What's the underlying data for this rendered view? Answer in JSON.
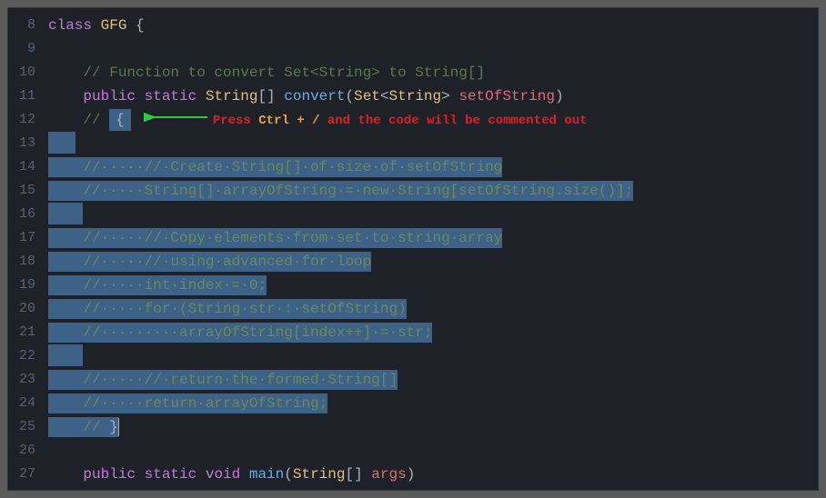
{
  "gutter": {
    "start": 8,
    "end": 27
  },
  "annotation": {
    "press": "Press",
    "key": "Ctrl + /",
    "rest": "and the code will be commented out"
  },
  "lines": {
    "l8_class": "class",
    "l8_gfg": " GFG ",
    "l8_brace": "{",
    "l10_c": "    // Function to convert Set<String> to String[]",
    "l11_pub": "    public",
    "l11_static": " static",
    "l11_string": " String",
    "l11_arr": "[] ",
    "l11_convert": "convert",
    "l11_open": "(",
    "l11_set": "Set",
    "l11_lt": "<",
    "l11_str2": "String",
    "l11_gt": "> ",
    "l11_param": "setOfString",
    "l11_close": ")",
    "l12_c": "    // ",
    "l12_brace": "{",
    "l13_sel": "",
    "l14_c": "    //·····//·Create·String[]·of·size·of·setOfString",
    "l15_c": "    //·····String[]·arrayOfString·=·new·String[setOfString.size()];",
    "l17_c": "    //·····//·Copy·elements·from·set·to·string·array",
    "l18_c": "    //·····//·using·advanced·for·loop",
    "l19_c": "    //·····int·index·=·0;",
    "l20_c": "    //·····for·(String·str·:·setOfString)",
    "l21_c": "    //·········arrayOfString[index++]·=·str;",
    "l23_c": "    //·····//·return·the·formed·String[]",
    "l24_c": "    //·····return·arrayOfString;",
    "l25_c": "    // ",
    "l25_brace": "}",
    "l27_pub": "    public",
    "l27_static": " static",
    "l27_void": " void",
    "l27_main": " main",
    "l27_open": "(",
    "l27_string": "String",
    "l27_arr": "[] ",
    "l27_args": "args",
    "l27_close": ")"
  }
}
